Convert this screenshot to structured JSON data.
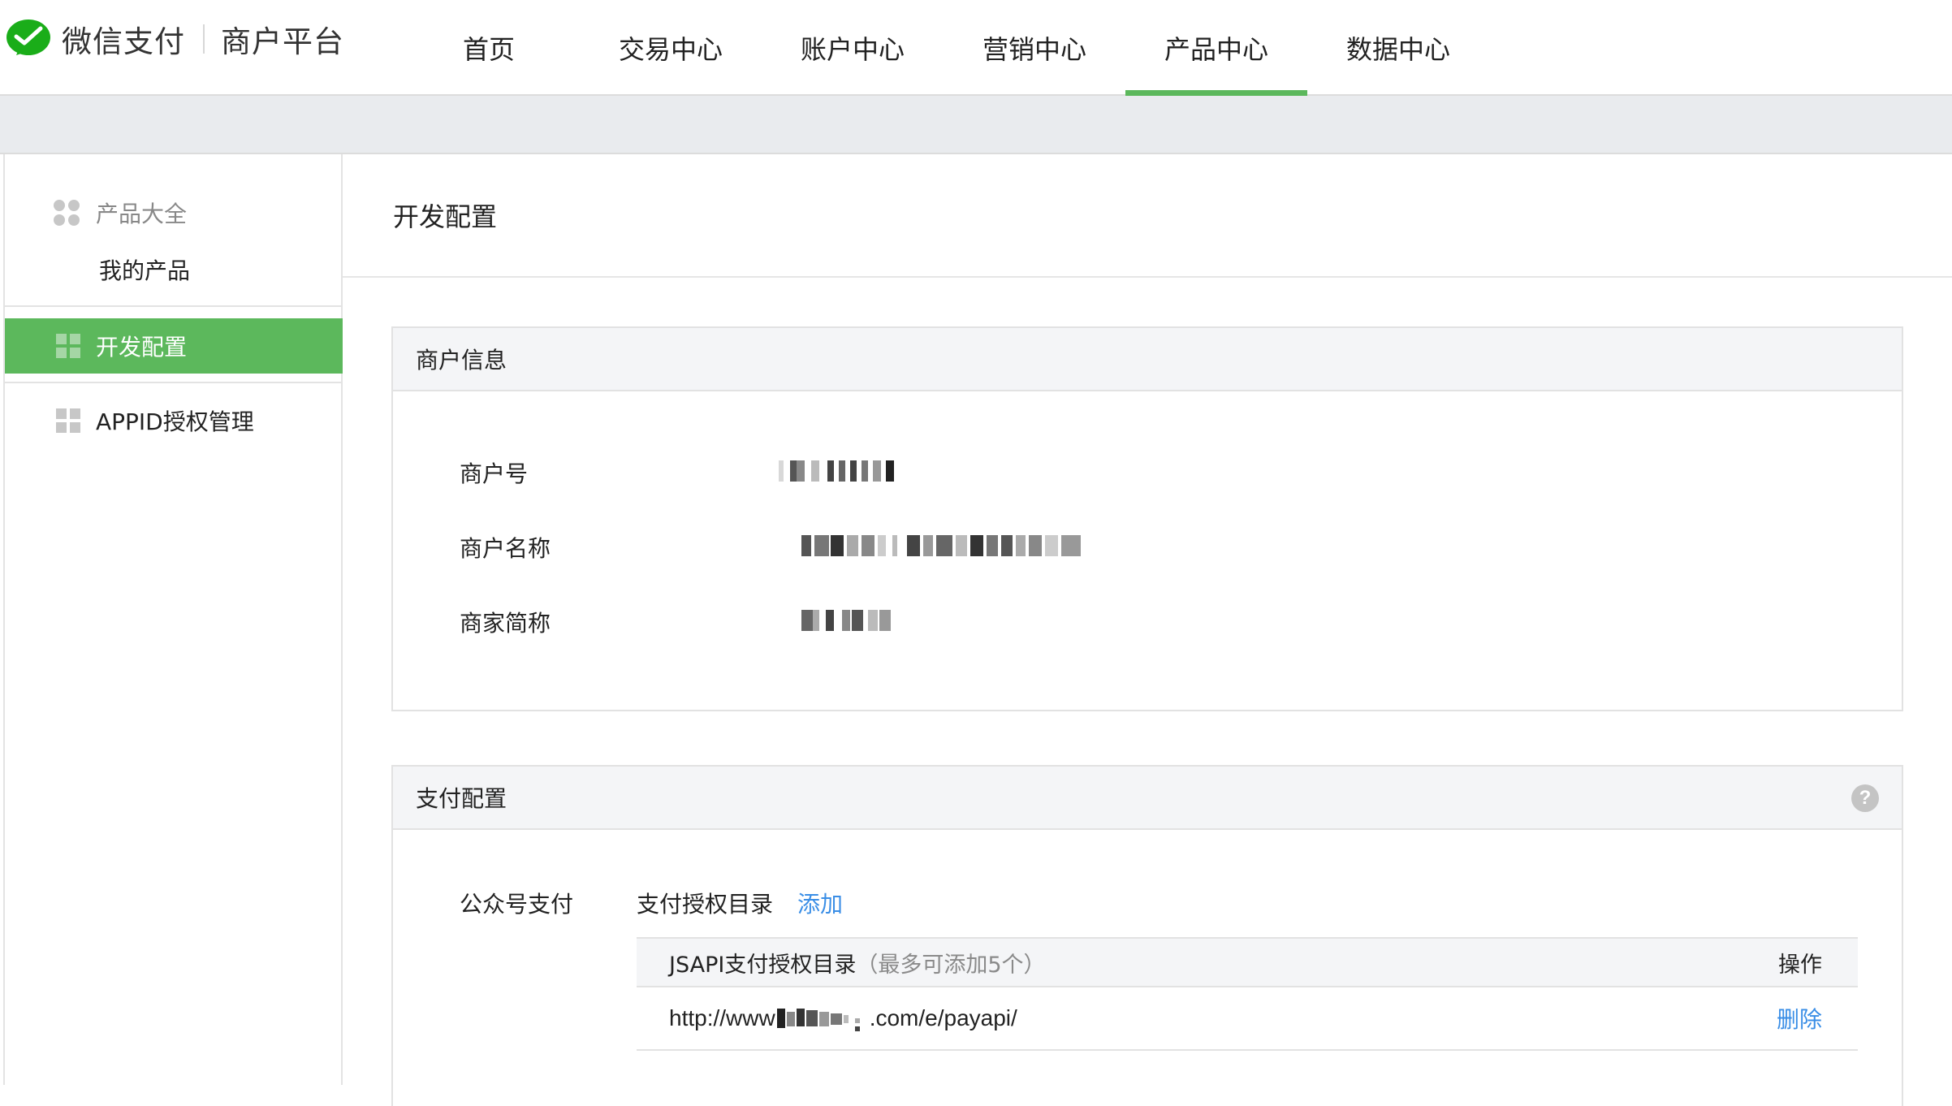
{
  "header": {
    "brand": "微信支付",
    "platform": "商户平台",
    "nav": [
      {
        "label": "首页",
        "active": false
      },
      {
        "label": "交易中心",
        "active": false
      },
      {
        "label": "账户中心",
        "active": false
      },
      {
        "label": "营销中心",
        "active": false
      },
      {
        "label": "产品中心",
        "active": true
      },
      {
        "label": "数据中心",
        "active": false
      }
    ]
  },
  "sidebar": {
    "group_title": "产品大全",
    "sub_item": "我的产品",
    "items": [
      {
        "label": "开发配置",
        "active": true
      },
      {
        "label": "APPID授权管理",
        "active": false
      }
    ]
  },
  "main": {
    "title": "开发配置",
    "merchant_panel": {
      "title": "商户信息",
      "rows": [
        {
          "label": "商户号"
        },
        {
          "label": "商户名称"
        },
        {
          "label": "商家简称"
        }
      ]
    },
    "pay_panel": {
      "title": "支付配置",
      "help": "?",
      "section_label": "公众号支付",
      "dir_label": "支付授权目录",
      "add_label": "添加",
      "table": {
        "header_main": "JSAPI支付授权目录",
        "header_note": "（最多可添加5个）",
        "header_op": "操作",
        "rows": [
          {
            "url_prefix": "http://www",
            "url_suffix": ".com/e/payapi/",
            "action": "删除"
          }
        ]
      }
    }
  },
  "colors": {
    "accent_green": "#5cb85c",
    "link_blue": "#3a8ee6",
    "band_gray": "#e9ebee"
  }
}
